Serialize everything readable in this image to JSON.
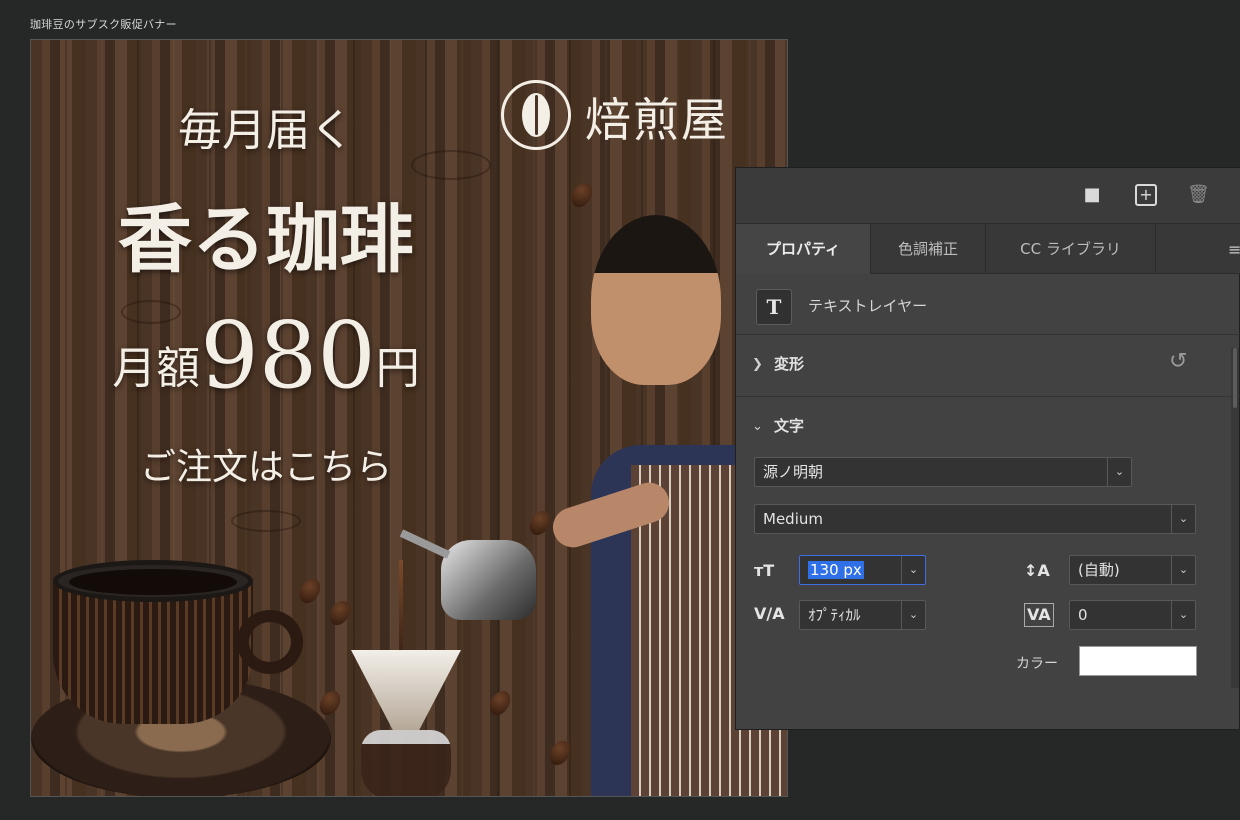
{
  "document": {
    "title": "珈琲豆のサブスク販促バナー"
  },
  "banner": {
    "line1": "毎月届く",
    "line2": "香る珈琲",
    "price_prefix": "月額",
    "price_amount": "980",
    "price_suffix": "円",
    "cta": "ご注文はこちら",
    "brand": "焙煎屋"
  },
  "panel": {
    "tabs": [
      {
        "label": "プロパティ"
      },
      {
        "label": "色調補正"
      },
      {
        "label": "CC ライブラリ"
      }
    ],
    "layer_type": "テキストレイヤー",
    "sections": {
      "transform": "変形",
      "character": "文字"
    },
    "character": {
      "font_family": "源ノ明朝",
      "font_style": "Medium",
      "font_size": "130 px",
      "leading": "(自動)",
      "kerning": "ｵﾌﾟﾃｨｶﾙ",
      "tracking": "0",
      "color_label": "カラー",
      "color_value": "#ffffff"
    }
  },
  "colors": {
    "workspace_bg": "#252827",
    "panel_bg": "#424242",
    "selection_blue": "#2f6fe7",
    "banner_text": "#f4efe6"
  }
}
